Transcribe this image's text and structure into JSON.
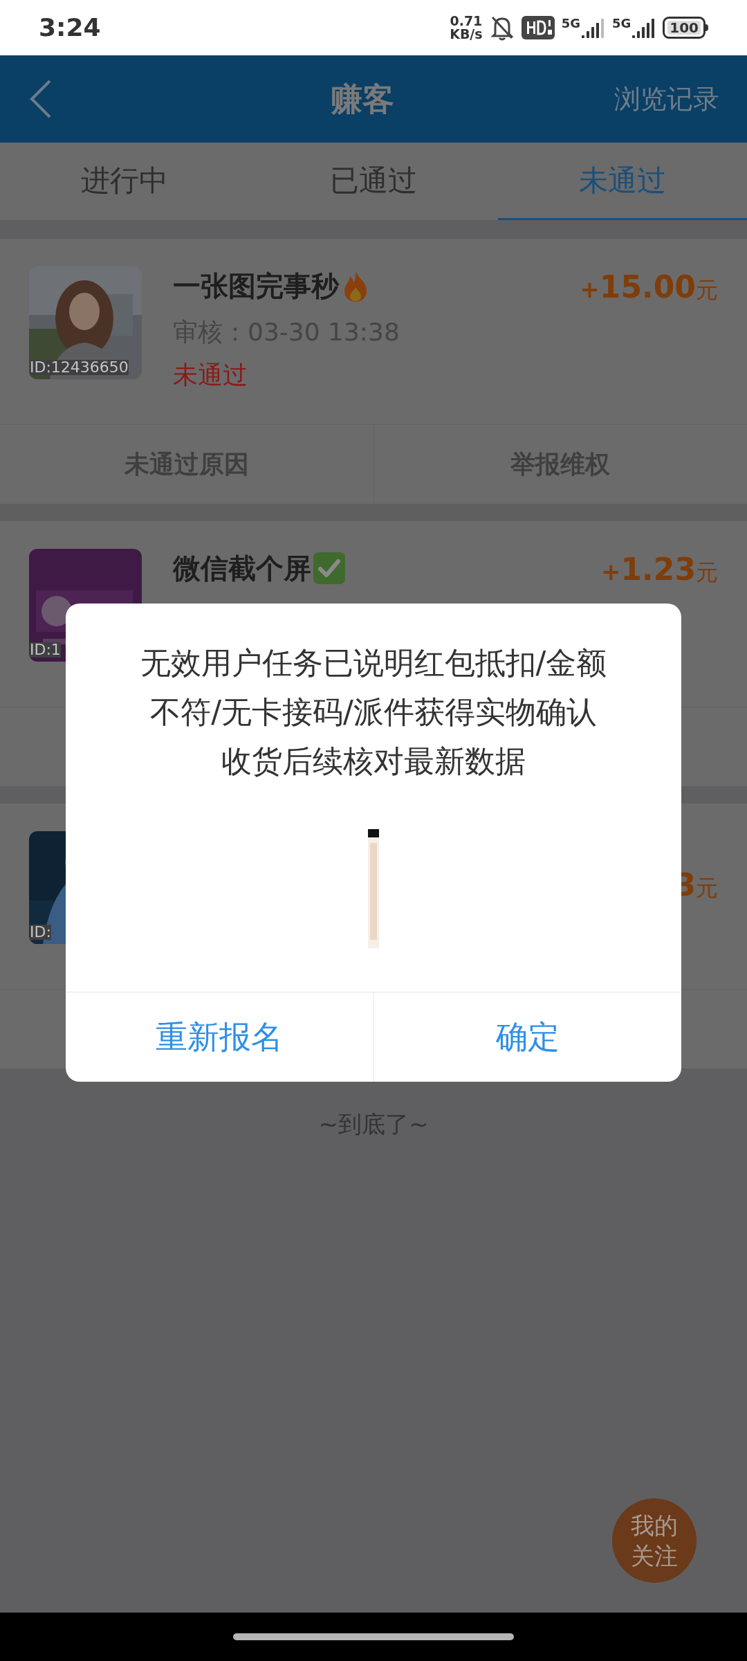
{
  "status_bar": {
    "time": "3:24",
    "net_speed": [
      "0.71",
      "KB/s"
    ],
    "networks": [
      "5G",
      "5G"
    ],
    "battery": "100"
  },
  "header": {
    "title": "赚客",
    "action": "浏览记录"
  },
  "tabs": [
    {
      "label": "进行中",
      "selected": false
    },
    {
      "label": "已通过",
      "selected": false
    },
    {
      "label": "未通过",
      "selected": true
    }
  ],
  "tasks": [
    {
      "thumb": {
        "kind": "picture"
      },
      "thumb_id": "ID:12436650",
      "title": "一张图完事秒",
      "title_icon": {
        "kind": "fire"
      },
      "review": "审核：03-30 13:38",
      "status": "未通过",
      "amount": {
        "sign": "+",
        "value": "15.00",
        "unit": "元"
      },
      "actions": [
        "未通过原因",
        "举报维权"
      ]
    },
    {
      "thumb": {
        "kind": "picture"
      },
      "thumb_id": "ID:1",
      "title": "微信截个屏",
      "title_icon": {
        "kind": "check"
      },
      "amount": {
        "sign": "+",
        "value": "1.23",
        "unit": "元"
      }
    },
    {
      "thumb": {
        "kind": "picture"
      },
      "thumb_id": "ID:",
      "amount": {
        "value": "3",
        "unit": "元"
      }
    }
  ],
  "footer_text": "~到底了~",
  "floating_button": "我的关注",
  "dialog": {
    "message": "无效用户任务已说明红包抵扣/金额不符/无卡接码/派件获得实物确认收货后续核对最新数据",
    "buttons": [
      "重新报名",
      "确定"
    ]
  }
}
